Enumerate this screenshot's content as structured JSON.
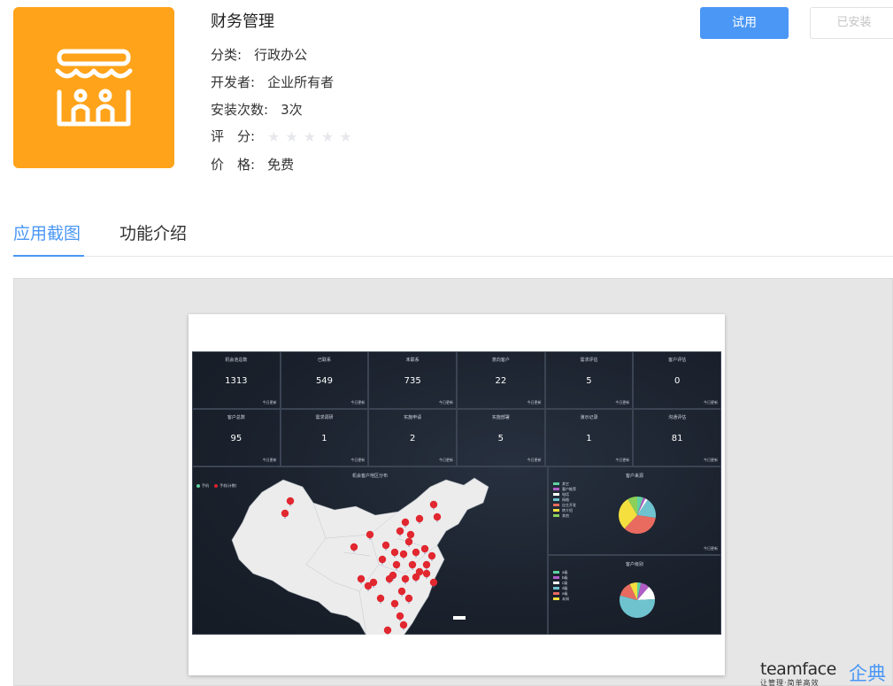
{
  "app": {
    "title": "财务管理",
    "icon": "storefront-icon",
    "icon_color": "#ffa31a",
    "category_label": "分类:",
    "category_value": "行政办公",
    "developer_label": "开发者:",
    "developer_value": "企业所有者",
    "installs_label": "安装次数:",
    "installs_value": "3次",
    "rating_label": "评　分:",
    "rating_value": 0,
    "rating_max": 5,
    "price_label": "价　格:",
    "price_value": "免费"
  },
  "actions": {
    "try_label": "试用",
    "installed_label": "已安装",
    "accent": "#4a97f5"
  },
  "tabs": [
    {
      "label": "应用截图",
      "active": true
    },
    {
      "label": "功能介绍",
      "active": false
    }
  ],
  "screenshot": {
    "stats": [
      {
        "label": "机会池总数",
        "value": "1313",
        "note": "今日更新"
      },
      {
        "label": "已联系",
        "value": "549",
        "note": "今日更新"
      },
      {
        "label": "未联系",
        "value": "735",
        "note": "今日更新"
      },
      {
        "label": "意向客户",
        "value": "22",
        "note": "今日更新"
      },
      {
        "label": "需求评估",
        "value": "5",
        "note": "今日更新"
      },
      {
        "label": "客户评估",
        "value": "0",
        "note": "今日更新"
      },
      {
        "label": "客户总数",
        "value": "95",
        "note": "今日更新"
      },
      {
        "label": "需求调研",
        "value": "1",
        "note": "今日更新"
      },
      {
        "label": "实施申请",
        "value": "2",
        "note": "今日更新"
      },
      {
        "label": "实施部署",
        "value": "5",
        "note": "今日更新"
      },
      {
        "label": "演示记录",
        "value": "1",
        "note": "今日更新"
      },
      {
        "label": "沟通评估",
        "value": "81",
        "note": "今日更新"
      }
    ],
    "map_title": "机会客户地区分布",
    "map_legend": [
      "手机",
      "手机(计数)"
    ],
    "source_title": "客户来源",
    "source_legend": [
      "其它",
      "客户推荐",
      "电话",
      "网络",
      "自主开发",
      "转介绍",
      "其他"
    ],
    "source_colors": [
      "#5fd1a0",
      "#b05cc6",
      "#ffffff",
      "#6ec3cf",
      "#e96b5f",
      "#f5df3f",
      "#8cd05a"
    ],
    "source_slices": [
      {
        "label": "其它",
        "value": 5
      },
      {
        "label": "客户推荐",
        "value": 2
      },
      {
        "label": "电话",
        "value": 2
      },
      {
        "label": "网络",
        "value": 17
      },
      {
        "label": "自主开发",
        "value": 33
      },
      {
        "label": "转介绍",
        "value": 28
      },
      {
        "label": "其他",
        "value": 8
      }
    ],
    "level_title": "客户级别",
    "level_legend": [
      "a级",
      "b级",
      "c级",
      "d级",
      "e级",
      "未知"
    ],
    "level_colors": [
      "#5fd1a0",
      "#b05cc6",
      "#ffffff",
      "#6ec3cf",
      "#e96b5f",
      "#f5df3f"
    ],
    "level_slices": [
      {
        "label": "a级",
        "value": 3
      },
      {
        "label": "b级",
        "value": 7
      },
      {
        "label": "c级",
        "value": 11
      },
      {
        "label": "d级",
        "value": 48
      },
      {
        "label": "e级",
        "value": 12
      },
      {
        "label": "未知",
        "value": 6
      }
    ]
  },
  "brand": {
    "name": "teamface",
    "name_cn": "企典",
    "slogan": "让管理·简单高效"
  }
}
